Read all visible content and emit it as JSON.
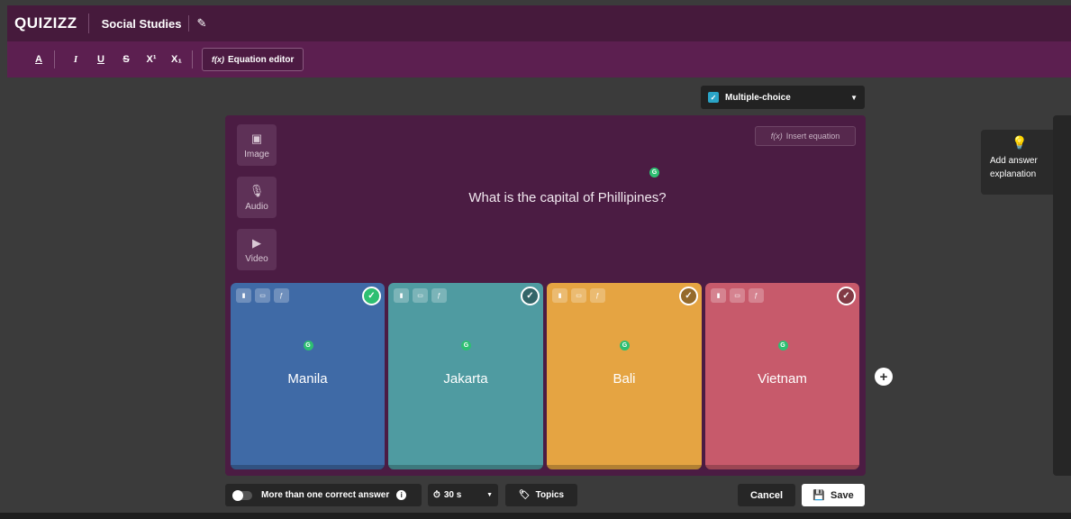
{
  "header": {
    "logo": "QUIZIZZ",
    "doc_title": "Social Studies",
    "edit_icon": "pencil-icon"
  },
  "toolbar": {
    "buttons": [
      "A",
      "I",
      "U",
      "S",
      "X¹",
      "X₁"
    ],
    "equation_editor": "Equation editor",
    "equation_prefix": "f(x)"
  },
  "question_type": {
    "selected": "Multiple-choice"
  },
  "media": {
    "image": "Image",
    "audio": "Audio",
    "video": "Video"
  },
  "insert_equation": "Insert equation",
  "question": "What is the capital of Phillipines?",
  "answers": [
    {
      "text": "Manila",
      "color": "#3f6aa6",
      "correct": true
    },
    {
      "text": "Jakarta",
      "color": "#4f9ba1",
      "correct": false
    },
    {
      "text": "Bali",
      "color": "#e5a442",
      "correct": false
    },
    {
      "text": "Vietnam",
      "color": "#c75a6b",
      "correct": false
    }
  ],
  "explanation": {
    "label": "Add answer explanation"
  },
  "footer": {
    "multiple_correct_label": "More than one correct answer",
    "timer": "30 s",
    "topics": "Topics",
    "cancel": "Cancel",
    "save": "Save"
  }
}
